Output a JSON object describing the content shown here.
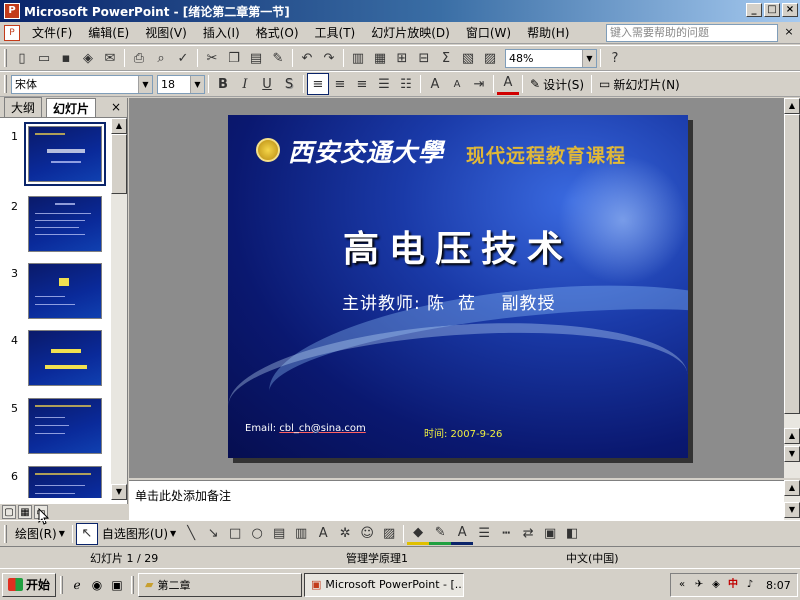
{
  "window": {
    "title": "Microsoft PowerPoint - [绪论第二章第一节]",
    "min": "_",
    "max": "□",
    "close": "×"
  },
  "menu": {
    "items": [
      "文件(F)",
      "编辑(E)",
      "视图(V)",
      "插入(I)",
      "格式(O)",
      "工具(T)",
      "幻灯片放映(D)",
      "窗口(W)",
      "帮助(H)"
    ],
    "help_placeholder": "键入需要帮助的问题",
    "close": "×"
  },
  "toolbar": {
    "zoom": "48%",
    "font_name": "宋体",
    "font_size": "18",
    "bold": "B",
    "italic": "I",
    "underline": "U",
    "shadow": "S",
    "design_label": "设计(S)",
    "new_slide_label": "新幻灯片(N)"
  },
  "outline_pane": {
    "tab_outline": "大纲",
    "tab_slides": "幻灯片",
    "close": "×",
    "thumbnails": [
      {
        "num": "1",
        "selected": true
      },
      {
        "num": "2",
        "selected": false
      },
      {
        "num": "3",
        "selected": false
      },
      {
        "num": "4",
        "selected": false
      },
      {
        "num": "5",
        "selected": false
      },
      {
        "num": "6",
        "selected": false
      }
    ]
  },
  "slide": {
    "university": "西安交通大學",
    "course": "现代远程教育课程",
    "title": "高电压技术",
    "lecturer": "主讲教师: 陈  莅    副教授",
    "email_label": "Email:",
    "email": "cbl_ch@sina.com",
    "date": "时间: 2007-9-26"
  },
  "notes": {
    "placeholder": "单击此处添加备注"
  },
  "draw_toolbar": {
    "draw_label": "绘图(R)",
    "autoshapes_label": "自选图形(U)"
  },
  "status": {
    "slide_counter": "幻灯片 1 / 29",
    "design": "管理学原理1",
    "language": "中文(中国)"
  },
  "taskbar": {
    "start": "开始",
    "tasks": [
      "第二章",
      "Microsoft PowerPoint - [..."
    ],
    "tray_chevron": "«",
    "time": "8:07"
  },
  "colors": {
    "titlebar": "#0a246a",
    "slide_bg": "#0a1870",
    "course_text": "#e0b838",
    "date_text": "#f0f040"
  }
}
